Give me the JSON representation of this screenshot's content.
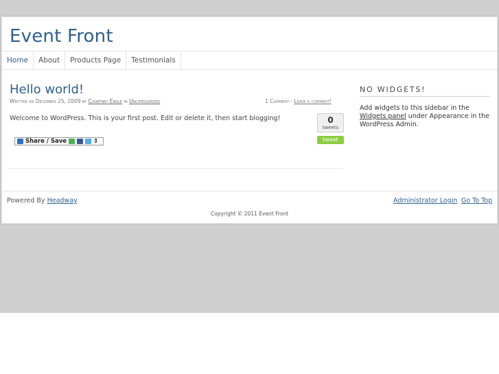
{
  "site": {
    "title": "Event Front"
  },
  "nav": {
    "items": [
      "Home",
      "About",
      "Products Page",
      "Testimonials"
    ]
  },
  "post": {
    "title": "Hello world!",
    "meta_prefix": "Written on December 25, 2009 by ",
    "author": "Courtney Engle",
    "meta_mid": " in ",
    "category": "Uncategorized",
    "comments": "1 Comment",
    "comments_sep": " - ",
    "leave_comment": "Leave a comment!",
    "body": "Welcome to WordPress. This is your first post. Edit or delete it, then start blogging!",
    "tweet_count": "0",
    "tweet_label": "tweets",
    "tweet_button": "tweet",
    "share_label": "Share / Save",
    "share_arrow": "⇕"
  },
  "sidebar": {
    "title": "NO WIDGETS!",
    "text_before": "Add widgets to this sidebar in the ",
    "link": "Widgets panel",
    "text_after": " under Appearance in the WordPress Admin."
  },
  "footer": {
    "powered_prefix": "Powered By ",
    "powered_link": "Headway",
    "admin_login": "Administrator Login",
    "go_to_top": "Go To Top",
    "copyright": "Copyright © 2011 Event Front"
  },
  "colors": {
    "accent": "#2e5f8e",
    "tweet_green": "#8dcd3f",
    "background": "#cfcfcf"
  }
}
